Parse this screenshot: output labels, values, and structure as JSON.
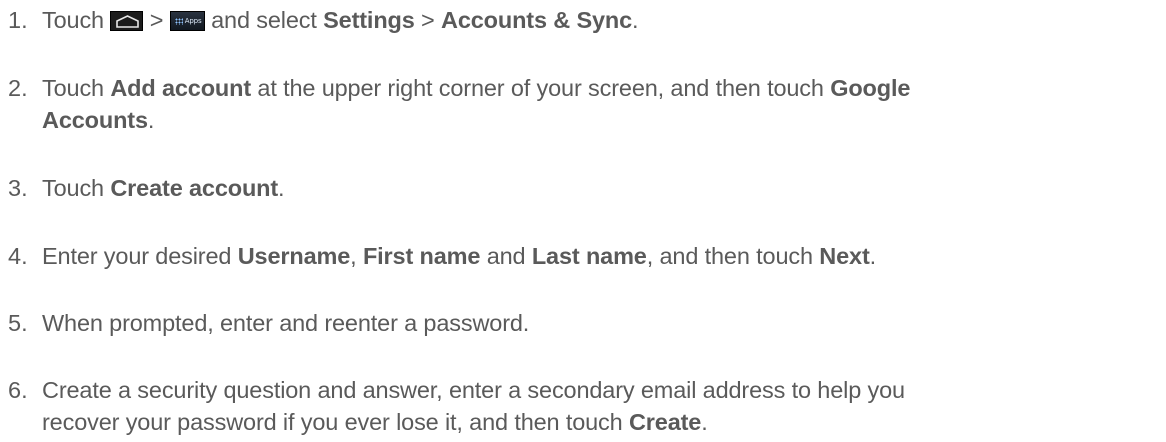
{
  "steps": [
    {
      "number": "1.",
      "parts": {
        "p1": "Touch",
        "sep1": ">",
        "p2": "and select",
        "b1": "Settings",
        "sep2": ">",
        "b2": "Accounts & Sync",
        "end": "."
      },
      "icons": [
        "home-icon",
        "apps-icon"
      ],
      "apps_icon_label": "Apps"
    },
    {
      "number": "2.",
      "parts": {
        "p1": "Touch",
        "b1": "Add account",
        "p2": "at the upper right corner of your screen, and then touch",
        "b2": "Google",
        "b3": "Accounts",
        "end": "."
      }
    },
    {
      "number": "3.",
      "parts": {
        "p1": "Touch",
        "b1": "Create account",
        "end": "."
      }
    },
    {
      "number": "4.",
      "parts": {
        "p1": "Enter your desired",
        "b1": "Username",
        "c1": ",",
        "b2": "First name",
        "p2": "and",
        "b3": "Last name",
        "p3": ", and then touch",
        "b4": "Next",
        "end": "."
      }
    },
    {
      "number": "5.",
      "parts": {
        "p1": "When prompted, enter and reenter a password."
      }
    },
    {
      "number": "6.",
      "parts": {
        "p1": "Create a security question and answer, enter a secondary email address to help you",
        "p2": "recover your password if you ever lose it, and then touch",
        "b1": "Create",
        "end": "."
      }
    }
  ]
}
